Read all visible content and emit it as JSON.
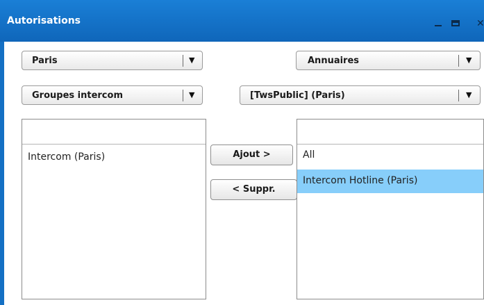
{
  "window": {
    "title": "Autorisations"
  },
  "left": {
    "site_select": {
      "value": "Paris"
    },
    "type_select": {
      "value": "Groupes intercom"
    },
    "list": {
      "items": [
        "Intercom (Paris)"
      ]
    }
  },
  "right": {
    "category_select": {
      "value": "Annuaires"
    },
    "directory_select": {
      "value": "[TwsPublic] (Paris)"
    },
    "list": {
      "items": [
        "All",
        "Intercom Hotline (Paris)"
      ],
      "selected_index": 1
    }
  },
  "actions": {
    "add_label": "Ajout >",
    "remove_label": "< Suppr."
  },
  "colors": {
    "titlebar": "#1470c4",
    "selection": "#87cefa"
  }
}
